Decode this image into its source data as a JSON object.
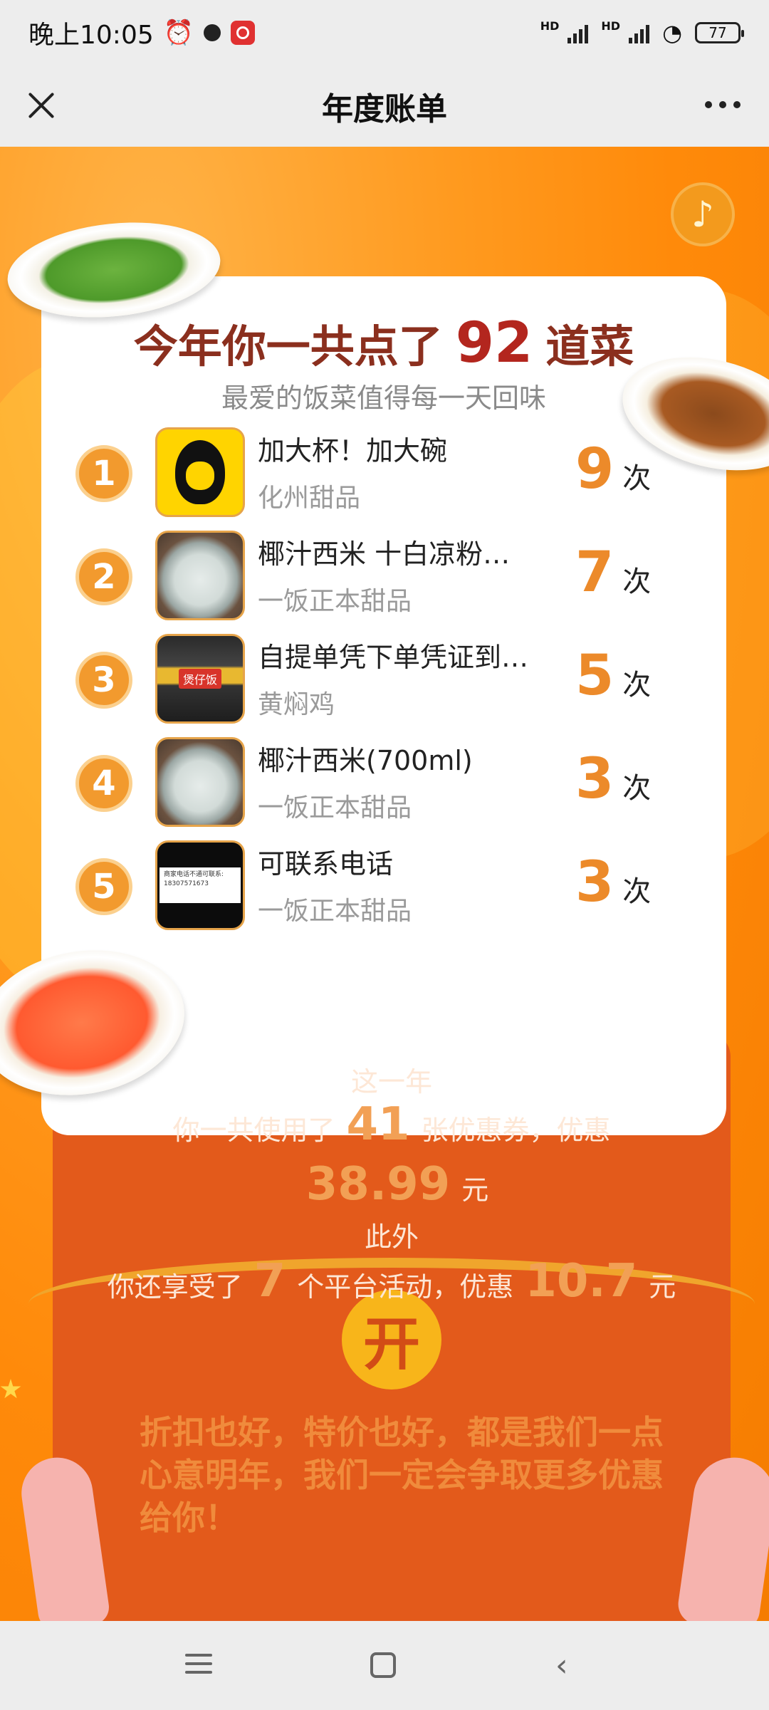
{
  "status_bar": {
    "time": "晚上10:05",
    "hd1": "HD",
    "hd2": "HD",
    "battery": "77",
    "icons": [
      "alarm-icon",
      "dot-icon",
      "netease-music-icon",
      "signal-icon",
      "wifi-icon",
      "battery-icon"
    ]
  },
  "nav": {
    "title": "年度账单",
    "close_icon": "close-icon",
    "more_icon": "more-icon"
  },
  "music_button": {
    "glyph": "♪"
  },
  "summary": {
    "prefix": "今年你一共点了",
    "count": "92",
    "suffix": "道菜",
    "subtitle": "最爱的饭菜值得每一天回味"
  },
  "ranking": [
    {
      "rank": "1",
      "name": "加大杯！加大碗",
      "shop": "化州甜品",
      "count": "9",
      "unit": "次",
      "thumb": "monkey-logo"
    },
    {
      "rank": "2",
      "name": "椰汁西米 十白凉粉…",
      "shop": "一饭正本甜品",
      "count": "7",
      "unit": "次",
      "thumb": "bowl-photo"
    },
    {
      "rank": "3",
      "name": "自提单凭下单凭证到…",
      "shop": "黄焖鸡",
      "count": "5",
      "unit": "次",
      "thumb": "shop-photo",
      "thumb_sign": "煲仔饭"
    },
    {
      "rank": "4",
      "name": "椰汁西米(700ml)",
      "shop": "一饭正本甜品",
      "count": "3",
      "unit": "次",
      "thumb": "bowl-photo"
    },
    {
      "rank": "5",
      "name": "可联系电话",
      "shop": "一饭正本甜品",
      "count": "3",
      "unit": "次",
      "thumb": "note-photo",
      "thumb_note": "商家电话不通可联系: 18307571673"
    }
  ],
  "coupon": {
    "line1": "这一年",
    "line2_prefix": "你一共使用了",
    "coupon_count": "41",
    "line2_suffix": "张优惠券，优惠",
    "saved_amount": "38.99",
    "saved_unit": "元",
    "line4": "此外",
    "line5_prefix": "你还享受了",
    "activity_count": "7",
    "line5_middle": "个平台活动，优惠",
    "activity_amount": "10.7",
    "activity_unit": "元",
    "seal": "开",
    "closing": "折扣也好，特价也好，都是我们一点心意明年，我们一定会争取更多优惠给你！"
  },
  "system_nav": {
    "menu_icon": "menu-icon",
    "home_icon": "home-icon",
    "back_icon": "back-icon",
    "back_glyph": "‹"
  },
  "colors": {
    "accent_orange": "#ff8a0a",
    "title_brown": "#8b2f1e",
    "count_red": "#b3261e",
    "envelope_red": "#e35a1b",
    "seal_yellow": "#f8b51a"
  }
}
